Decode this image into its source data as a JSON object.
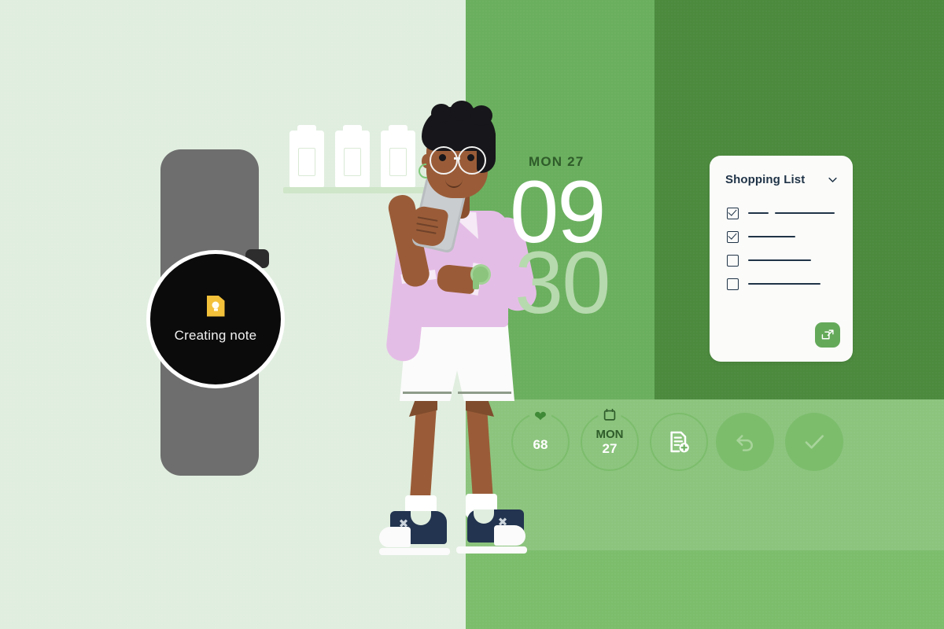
{
  "scene": {
    "title": "Wear OS Google Keep note creation illustration",
    "background": {
      "light_left": "#e0eedf",
      "mid_green": "#6aaf5e",
      "dark_green": "#4c8a3e",
      "bottom_light_green": "#8cc47e",
      "bottom_left_green": "#7cbd6c"
    }
  },
  "watch": {
    "band_color": "#6e6e6e",
    "face_color": "#0b0b0b",
    "app_icon": "google-keep-icon",
    "status_text": "Creating note"
  },
  "clock": {
    "date_label": "MON 27",
    "hour": "09",
    "minute": "30",
    "hour_color": "#ffffff",
    "minute_color": "#b7d9ae",
    "date_color": "#2f5c2a"
  },
  "card": {
    "title": "Shopping List",
    "chevron_icon": "chevron-down-icon",
    "fab_icon": "open-in-new-icon",
    "fab_color": "#64a95a",
    "rows": [
      {
        "checked": true,
        "rules": [
          26,
          76
        ]
      },
      {
        "checked": true,
        "rules": [
          60
        ]
      },
      {
        "checked": false,
        "rules": [
          80
        ]
      },
      {
        "checked": false,
        "rules": [
          92
        ]
      }
    ]
  },
  "strip": {
    "items": [
      {
        "id": "heart-rate",
        "icon": "heart-icon",
        "value": "68",
        "style": "ring",
        "state": "active"
      },
      {
        "id": "calendar",
        "icon": "calendar-icon",
        "dow": "MON",
        "day": "27",
        "style": "ring",
        "state": "active"
      },
      {
        "id": "new-note",
        "icon": "note-add-icon",
        "value": "",
        "style": "ring",
        "state": "active"
      },
      {
        "id": "undo",
        "icon": "undo-icon",
        "value": "",
        "style": "disc",
        "state": "dimmed"
      },
      {
        "id": "confirm",
        "icon": "check-icon",
        "value": "",
        "style": "disc",
        "state": "dimmed"
      }
    ]
  },
  "person": {
    "skin": "#9a5c38",
    "hair": "#17161a",
    "shirt": "#e4bde6",
    "shorts": "#fbfbfb",
    "shoes": "#22344f",
    "holding": "smartphone"
  },
  "shelf": {
    "jar_count": 3,
    "jar_color": "#ffffff",
    "board_color": "#cfe6c8"
  }
}
